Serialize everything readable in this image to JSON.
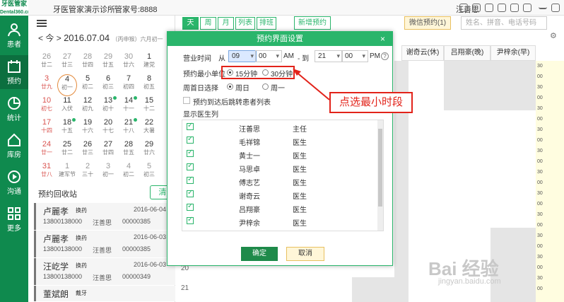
{
  "app": {
    "logo_cn": "牙医管家",
    "logo_en": "Dental360.cn",
    "clinic": "牙医管家演示诊所",
    "account": "管家号:8888",
    "user": "汪善思"
  },
  "nav": [
    {
      "label": "患者",
      "icon": "user-icon"
    },
    {
      "label": "预约",
      "icon": "calendar-icon"
    },
    {
      "label": "统计",
      "icon": "pie-chart-icon"
    },
    {
      "label": "库房",
      "icon": "home-icon"
    },
    {
      "label": "沟通",
      "icon": "play-icon"
    },
    {
      "label": "更多",
      "icon": "grid-icon"
    }
  ],
  "calendar": {
    "today_btn": "今",
    "date": "2016.07.04",
    "lunar": "（丙申猴）六月初一",
    "rows": [
      [
        {
          "d": "26",
          "l": "廿二"
        },
        {
          "d": "27",
          "l": "廿三"
        },
        {
          "d": "28",
          "l": "廿四"
        },
        {
          "d": "29",
          "l": "廿五"
        },
        {
          "d": "30",
          "l": "廿六"
        },
        {
          "d": "1",
          "l": "建党"
        }
      ],
      [
        {
          "d": "3",
          "l": "廿九"
        },
        {
          "d": "4",
          "l": "初一"
        },
        {
          "d": "5",
          "l": "初二"
        },
        {
          "d": "6",
          "l": "初三"
        },
        {
          "d": "7",
          "l": "初四"
        },
        {
          "d": "8",
          "l": "初五"
        }
      ],
      [
        {
          "d": "10",
          "l": "初七"
        },
        {
          "d": "11",
          "l": "入伏"
        },
        {
          "d": "12",
          "l": "初九"
        },
        {
          "d": "13",
          "l": "初十"
        },
        {
          "d": "14",
          "l": "十一"
        },
        {
          "d": "15",
          "l": "十二"
        }
      ],
      [
        {
          "d": "17",
          "l": "十四"
        },
        {
          "d": "18",
          "l": "十五"
        },
        {
          "d": "19",
          "l": "十六"
        },
        {
          "d": "20",
          "l": "十七"
        },
        {
          "d": "21",
          "l": "十八"
        },
        {
          "d": "22",
          "l": "大暑"
        }
      ],
      [
        {
          "d": "24",
          "l": "廿一"
        },
        {
          "d": "25",
          "l": "廿二"
        },
        {
          "d": "26",
          "l": "廿三"
        },
        {
          "d": "27",
          "l": "廿四"
        },
        {
          "d": "28",
          "l": "廿五"
        },
        {
          "d": "29",
          "l": "廿六"
        }
      ],
      [
        {
          "d": "31",
          "l": "廿八"
        },
        {
          "d": "1",
          "l": "建军节"
        },
        {
          "d": "2",
          "l": "三十"
        },
        {
          "d": "3",
          "l": "初一"
        },
        {
          "d": "4",
          "l": "初二"
        },
        {
          "d": "5",
          "l": "初三"
        }
      ]
    ]
  },
  "recycle": {
    "title": "预约回收站",
    "clear": "清",
    "items": [
      {
        "name": "卢麗孝",
        "tag": "换药",
        "date": "2016-06-04",
        "phone": "13800138000",
        "doctor": "汪善思",
        "num": "00000385"
      },
      {
        "name": "卢麗孝",
        "tag": "换药",
        "date": "2016-06-03",
        "phone": "13800138000",
        "doctor": "汪善思",
        "num": "00000385"
      },
      {
        "name": "汪屹学",
        "tag": "换药",
        "date": "2016-06-03",
        "phone": "13800138000",
        "doctor": "汪善思",
        "num": "00000349"
      },
      {
        "name": "董斌朗",
        "tag": "戴牙",
        "date": "",
        "phone": "",
        "doctor": "",
        "num": ""
      }
    ]
  },
  "main": {
    "tabs": [
      "天",
      "周",
      "月",
      "列表",
      "排班"
    ],
    "new_appt": "新增预约",
    "wechat": "微信预约(1)",
    "search_placeholder": "姓名、拼音、电话号码",
    "columns": [
      "谢奇云(休)",
      "吕翔豪(晚)",
      "尹梓余(早)"
    ],
    "hours": [
      "20",
      "21"
    ]
  },
  "dialog": {
    "title": "预约界面设置",
    "close": "×",
    "hours_label": "营业时间",
    "from": "从",
    "from_h": "09",
    "from_m": "00",
    "am": "AM",
    "to": "- 到",
    "to_h": "21",
    "to_m": "00",
    "pm": "PM",
    "min_unit_label": "预约最小单位",
    "opt15": "15分钟",
    "opt30": "30分钟",
    "weekstart_label": "周首日选择",
    "sun": "周日",
    "mon": "周一",
    "jump_label": "预约到达后跳转患者列表",
    "show_doctors": "显示医生列",
    "doctors": [
      {
        "name": "汪善思",
        "title": "主任"
      },
      {
        "name": "毛祥锦",
        "title": "医生"
      },
      {
        "name": "黄士一",
        "title": "医生"
      },
      {
        "name": "马思卓",
        "title": "医生"
      },
      {
        "name": "傅志艺",
        "title": "医生"
      },
      {
        "name": "谢奇云",
        "title": "医生"
      },
      {
        "name": "吕翔豪",
        "title": "医生"
      },
      {
        "name": "尹梓余",
        "title": "医生"
      }
    ],
    "ok": "确定",
    "cancel": "取消"
  },
  "callout": "点选最小时段",
  "watermark": "Bai 经验",
  "watermark_url": "jingyan.baidu.com",
  "colors": {
    "brand": "#2ab56b",
    "nav": "#0f8a4e",
    "annotation": "#e2231a"
  }
}
